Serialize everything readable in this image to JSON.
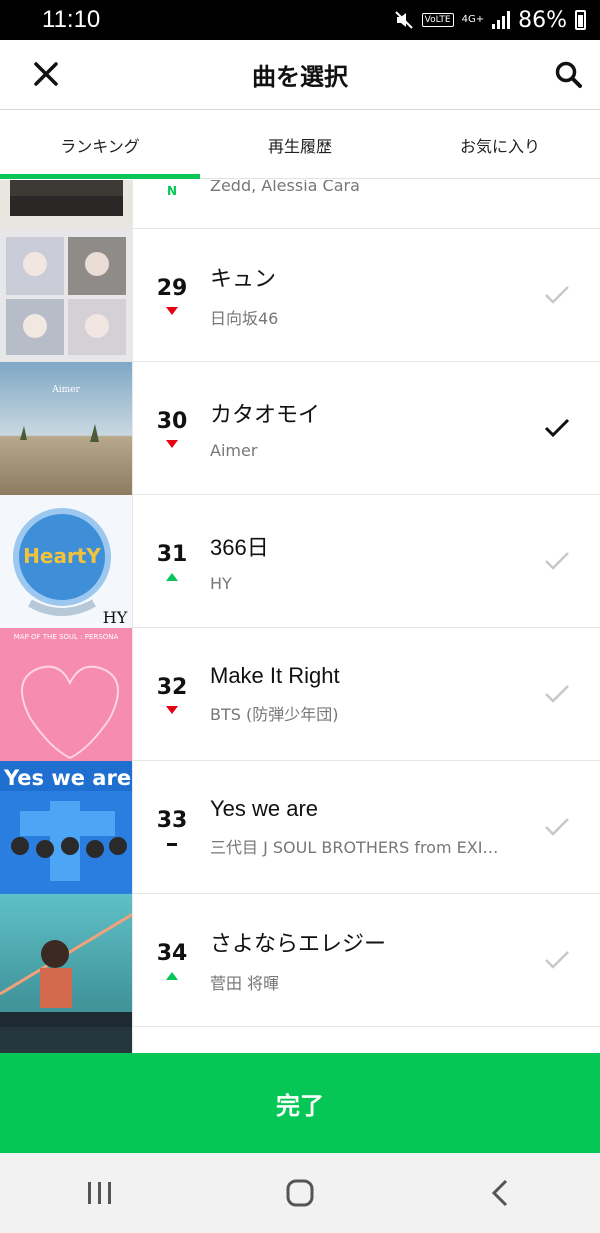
{
  "status_bar": {
    "time": "11:10",
    "network": "4G+",
    "volte": "VoLTE",
    "battery": "86%"
  },
  "header": {
    "title": "曲を選択",
    "close_icon": "close-icon",
    "search_icon": "search-icon"
  },
  "tabs": [
    {
      "label": "ランキング",
      "active": true
    },
    {
      "label": "再生履歴",
      "active": false
    },
    {
      "label": "お気に入り",
      "active": false
    }
  ],
  "songs": [
    {
      "rank": "",
      "trend": "new",
      "title": "",
      "artist": "Zedd, Alessia Cara",
      "selected": false
    },
    {
      "rank": "29",
      "trend": "down",
      "title": "キュン",
      "artist": "日向坂46",
      "selected": false
    },
    {
      "rank": "30",
      "trend": "down",
      "title": "カタオモイ",
      "artist": "Aimer",
      "selected": true
    },
    {
      "rank": "31",
      "trend": "up",
      "title": "366日",
      "artist": "HY",
      "selected": false
    },
    {
      "rank": "32",
      "trend": "down",
      "title": "Make It Right",
      "artist": "BTS (防弾少年団)",
      "selected": false
    },
    {
      "rank": "33",
      "trend": "flat",
      "title": "Yes we are",
      "artist": "三代目 J SOUL BROTHERS from EXI…",
      "selected": false
    },
    {
      "rank": "34",
      "trend": "up",
      "title": "さよならエレジー",
      "artist": "菅田 将暉",
      "selected": false
    }
  ],
  "album_art_text": {
    "aimer": "Aimer",
    "hy_main": "HeartY",
    "hy_sub": "HY",
    "bts": "MAP OF THE SOUL : PERSONA",
    "sjsb": "Yes we are"
  },
  "new_badge": "N",
  "done_button": "完了",
  "colors": {
    "accent": "#06c755",
    "down": "#e60012",
    "up": "#06c755"
  },
  "nav": [
    "recent-apps-icon",
    "home-icon",
    "back-icon"
  ]
}
